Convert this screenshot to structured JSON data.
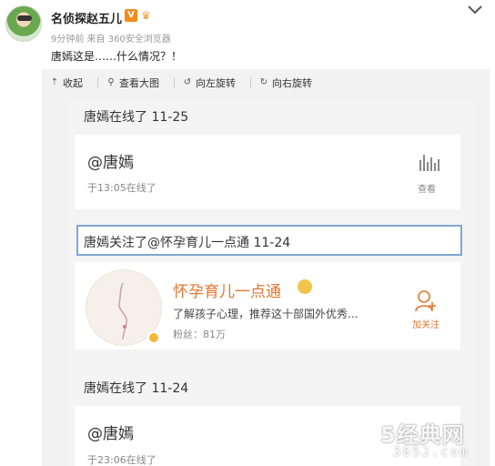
{
  "post": {
    "author": "名侦探赵五儿",
    "verified_badge": "V",
    "meta": "9分钟前 来自 360安全浏览器",
    "text": "唐嫣这是……什么情况？！"
  },
  "toolbar": {
    "collapse": "收起",
    "view_large": "查看大图",
    "rotate_left": "向左旋转",
    "rotate_right": "向右旋转"
  },
  "feed": {
    "sec1_title": "唐嫣在线了 11-25",
    "sec1_name": "@唐嫣",
    "sec1_time": "于13:05在线了",
    "sec1_action": "查看",
    "sec2_title": "唐嫣关注了@怀孕育儿一点通 11-24",
    "account_name": "怀孕育儿一点通",
    "account_desc": "了解孩子心理，推荐这十部国外优秀...",
    "account_fans": "粉丝：81万",
    "follow_label": "加关注",
    "sec3_title": "唐嫣在线了 11-24",
    "sec3_name": "@唐嫣",
    "sec3_time": "于23:06在线了"
  },
  "watermark": {
    "main": "5经典网",
    "sub": "365J.com"
  },
  "colors": {
    "accent_orange": "#e2762f",
    "highlight_border": "#7fa6d0",
    "verified_orange": "#f38c1b"
  }
}
